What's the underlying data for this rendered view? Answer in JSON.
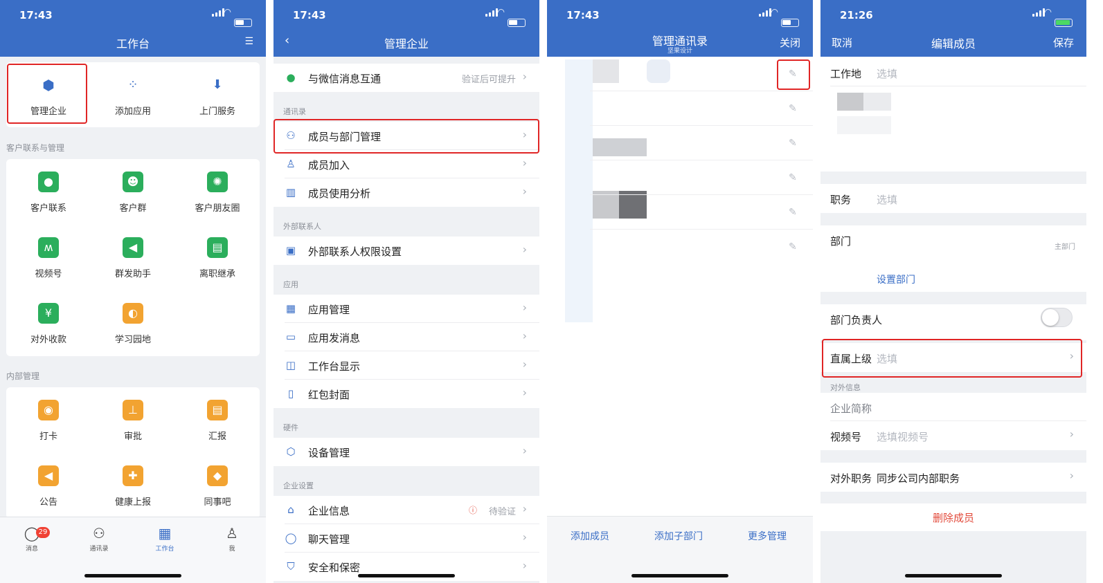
{
  "status": {
    "time1": "17:43",
    "time4": "21:26"
  },
  "s1": {
    "title": "工作台",
    "top": [
      "管理企业",
      "添加应用",
      "上门服务"
    ],
    "sec_customer": "客户联系与管理",
    "customer": [
      "客户联系",
      "客户群",
      "客户朋友圈",
      "视频号",
      "群发助手",
      "离职继承",
      "对外收款",
      "学习园地"
    ],
    "sec_internal": "内部管理",
    "internal": [
      "打卡",
      "审批",
      "汇报",
      "公告",
      "健康上报",
      "同事吧"
    ],
    "tabs": [
      "消息",
      "通讯录",
      "工作台",
      "我"
    ],
    "badge": "29",
    "colors": {
      "header": "#3a6ec6",
      "green": "#2bae5c",
      "orange": "#f2a331",
      "highlight": "#e02525"
    }
  },
  "s2": {
    "title": "管理企业",
    "wechat": "与微信消息互通",
    "wechat_note": "验证后可提升",
    "g_contacts": "通讯录",
    "members": "成员与部门管理",
    "join": "成员加入",
    "analysis": "成员使用分析",
    "g_external": "外部联系人",
    "ext_perm": "外部联系人权限设置",
    "g_apps": "应用",
    "app_manage": "应用管理",
    "app_msg": "应用发消息",
    "workbench": "工作台显示",
    "redpacket": "红包封面",
    "g_hardware": "硬件",
    "devices": "设备管理",
    "g_enterprise": "企业设置",
    "ent_info": "企业信息",
    "ent_note": "待验证",
    "chat": "聊天管理",
    "security": "安全和保密"
  },
  "s3": {
    "title": "管理通讯录",
    "subtitle": "坚果设计",
    "close": "关闭",
    "add_member": "添加成员",
    "add_sub": "添加子部门",
    "more": "更多管理"
  },
  "s4": {
    "cancel": "取消",
    "title": "编辑成员",
    "save": "保存",
    "workplace": "工作地",
    "placeholder": "选填",
    "position": "职务",
    "department": "部门",
    "main_dept": "主部门",
    "set_dept": "设置部门",
    "dept_head": "部门负责人",
    "superior": "直属上级",
    "ext_info": "对外信息",
    "short_name": "企业简称",
    "channels": "视频号",
    "channels_ph": "选填视频号",
    "ext_position": "对外职务",
    "ext_position_val": "同步公司内部职务",
    "delete": "删除成员"
  }
}
